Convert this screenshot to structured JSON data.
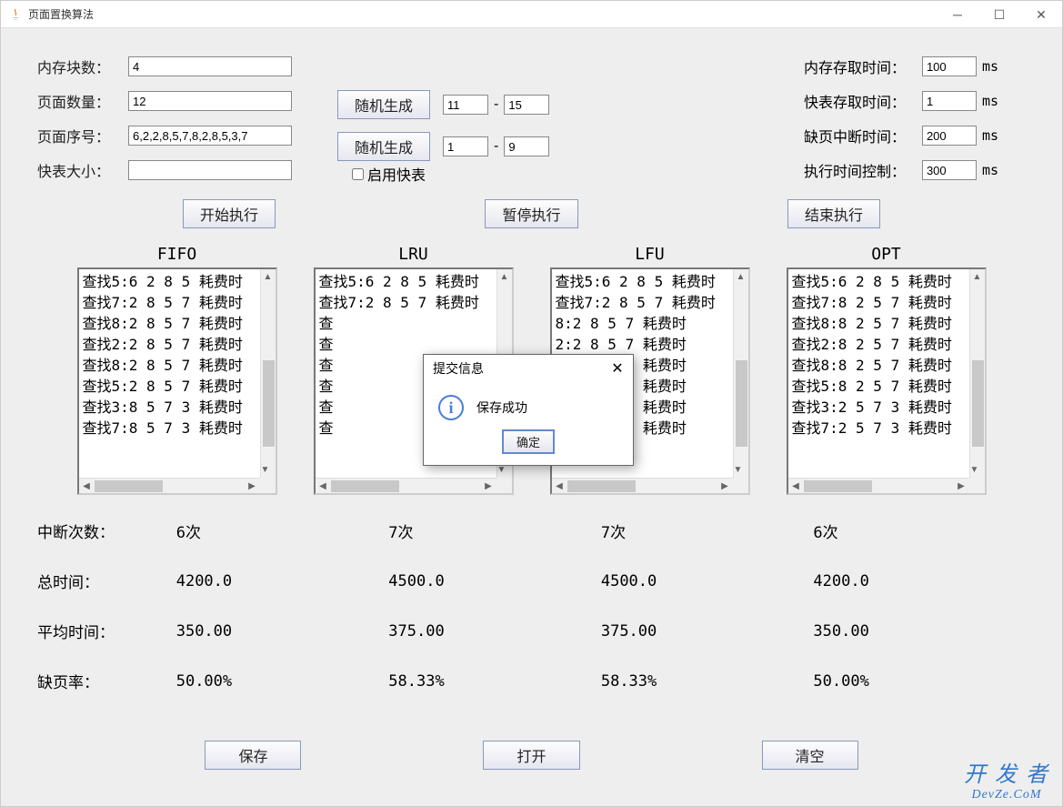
{
  "window_title": "页面置换算法",
  "labels": {
    "mem_blocks": "内存块数：",
    "page_count": "页面数量：",
    "page_seq": "页面序号：",
    "tlb_size": "快表大小：",
    "rand_gen": "随机生成",
    "enable_tlb": "启用快表",
    "mem_time": "内存存取时间：",
    "tlb_time": "快表存取时间：",
    "fault_time": "缺页中断时间：",
    "exec_ctrl": "执行时间控制：",
    "start": "开始执行",
    "pause": "暂停执行",
    "stop": "结束执行",
    "interrupts": "中断次数：",
    "total_time": "总时间：",
    "avg_time": "平均时间：",
    "fault_rate": "缺页率：",
    "save": "保存",
    "open": "打开",
    "clear": "清空",
    "ms": "ms",
    "dash": "-"
  },
  "inputs": {
    "mem_blocks": "4",
    "page_count": "12",
    "page_seq": "6,2,2,8,5,7,8,2,8,5,3,7",
    "tlb_size": "",
    "page_count_min": "11",
    "page_count_max": "15",
    "page_seq_min": "1",
    "page_seq_max": "9",
    "mem_time": "100",
    "tlb_time": "1",
    "fault_time": "200",
    "exec_ctrl": "300"
  },
  "algos": {
    "fifo": {
      "title": "FIFO",
      "lines": [
        "查找5:6 2 8 5 耗费时",
        "查找7:2 8 5 7 耗费时",
        "查找8:2 8 5 7 耗费时",
        "查找2:2 8 5 7 耗费时",
        "查找8:2 8 5 7 耗费时",
        "查找5:2 8 5 7 耗费时",
        "查找3:8 5 7 3 耗费时",
        "查找7:8 5 7 3 耗费时"
      ]
    },
    "lru": {
      "title": "LRU",
      "lines": [
        "查找5:6 2 8 5 耗费时",
        "查找7:2 8 5 7 耗费时",
        "查",
        "查",
        "查",
        "查",
        "查",
        "查"
      ]
    },
    "lfu": {
      "title": "LFU",
      "lines": [
        "查找5:6 2 8 5 耗费时",
        "查找7:2 8 5 7 耗费时",
        "8:2 8 5 7 耗费时",
        "2:2 8 5 7 耗费时",
        "8:2 8 5 7 耗费时",
        "5:2 8 5 7 耗费时",
        "3:2 8 5 3 耗费时",
        "7:2 8 5 7 耗费时"
      ]
    },
    "opt": {
      "title": "OPT",
      "lines": [
        "查找5:6 2 8 5 耗费时",
        "查找7:8 2 5 7 耗费时",
        "查找8:8 2 5 7 耗费时",
        "查找2:8 2 5 7 耗费时",
        "查找8:8 2 5 7 耗费时",
        "查找5:8 2 5 7 耗费时",
        "查找3:2 5 7 3 耗费时",
        "查找7:2 5 7 3 耗费时"
      ]
    }
  },
  "stats": {
    "fifo": {
      "interrupts": "6次",
      "total": "4200.0",
      "avg": "350.00",
      "rate": "50.00%"
    },
    "lru": {
      "interrupts": "7次",
      "total": "4500.0",
      "avg": "375.00",
      "rate": "58.33%"
    },
    "lfu": {
      "interrupts": "7次",
      "total": "4500.0",
      "avg": "375.00",
      "rate": "58.33%"
    },
    "opt": {
      "interrupts": "6次",
      "total": "4200.0",
      "avg": "350.00",
      "rate": "50.00%"
    }
  },
  "dialog": {
    "title": "提交信息",
    "msg": "保存成功",
    "ok": "确定"
  },
  "watermark": {
    "top": "开 发 者",
    "bottom": "DevZe.CoM"
  }
}
